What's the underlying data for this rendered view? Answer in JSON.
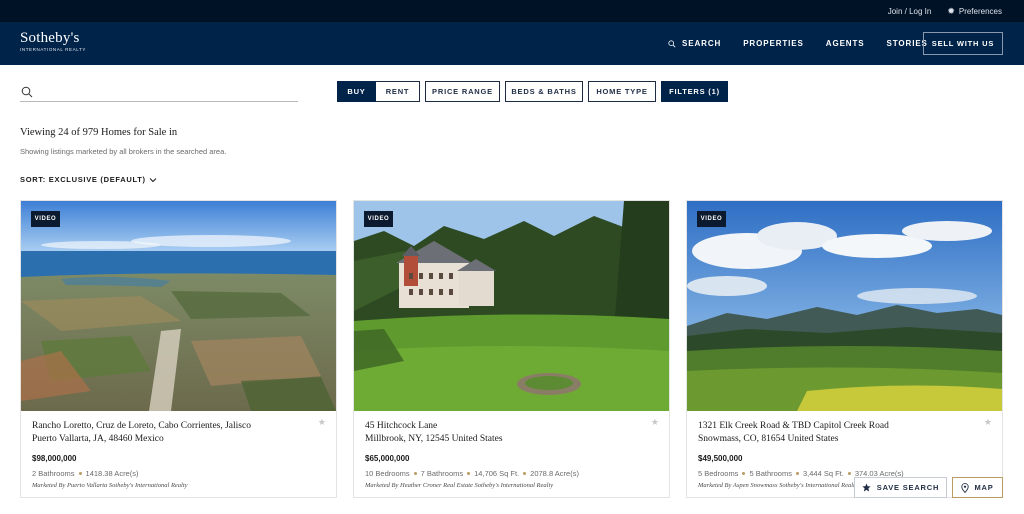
{
  "utility": {
    "join_label": "Join / Log In",
    "preferences_label": "Preferences",
    "preferences_icon": "gear-icon"
  },
  "header": {
    "logo_main": "Sotheby's",
    "logo_sub": "INTERNATIONAL REALTY",
    "nav": {
      "search": "SEARCH",
      "properties": "PROPERTIES",
      "agents": "AGENTS",
      "stories": "STORIES"
    },
    "sell_label": "SELL WITH US"
  },
  "search": {
    "value": "",
    "placeholder": ""
  },
  "filters": {
    "buy": "BUY",
    "rent": "RENT",
    "price_range": "PRICE RANGE",
    "beds_baths": "BEDS & BATHS",
    "home_type": "HOME TYPE",
    "filters": "FILTERS (1)"
  },
  "results": {
    "title": "Viewing 24 of 979 Homes for Sale in",
    "subtitle": "Showing listings marketed by all brokers in the searched area.",
    "sort_label": "SORT: EXCLUSIVE (DEFAULT)"
  },
  "listings": [
    {
      "badge": "VIDEO",
      "address_line1": "Rancho Loretto, Cruz de Loreto, Cabo Corrientes, Jalisco",
      "address_line2": "Puerto Vallarta, JA, 48460 Mexico",
      "price": "$98,000,000",
      "details": [
        "2 Bathrooms",
        "1418.38 Acre(s)"
      ],
      "marketed_by": "Marketed By Puerto Vallarta Sotheby's International Realty"
    },
    {
      "badge": "VIDEO",
      "address_line1": "45 Hitchcock Lane",
      "address_line2": "Millbrook, NY, 12545 United States",
      "price": "$65,000,000",
      "details": [
        "10 Bedrooms",
        "7 Bathrooms",
        "14,706 Sq Ft.",
        "2078.8 Acre(s)"
      ],
      "marketed_by": "Marketed By Heather Croner Real Estate Sotheby's International Realty"
    },
    {
      "badge": "VIDEO",
      "address_line1": "1321 Elk Creek Road & TBD Capitol Creek Road",
      "address_line2": "Snowmass, CO, 81654 United States",
      "price": "$49,500,000",
      "details": [
        "5 Bedrooms",
        "5 Bathrooms",
        "3,444 Sq Ft.",
        "374.03 Acre(s)"
      ],
      "marketed_by": "Marketed By Aspen Snowmass Sotheby's International Realty"
    }
  ],
  "actions": {
    "save_search": "SAVE SEARCH",
    "map": "MAP"
  },
  "colors": {
    "header": "#002349",
    "utility_bar": "#001226",
    "accent_gold": "#b99d63"
  }
}
